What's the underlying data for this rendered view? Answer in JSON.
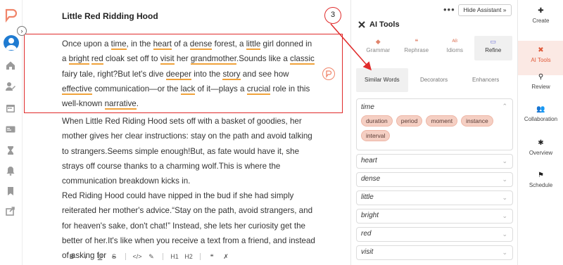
{
  "app": {
    "doc_title": "Little Red Ridding Hood",
    "accent_color": "#e05a3a",
    "highlight_color": "#e02b2b"
  },
  "left_rail": {
    "icons": [
      "logo-icon",
      "avatar",
      "home-icon",
      "user-edit-icon",
      "calendar-icon",
      "id-card-icon",
      "hourglass-icon",
      "bell-icon",
      "bookmark-icon",
      "share-icon"
    ]
  },
  "editor": {
    "p1": [
      {
        "t": "Once upon a "
      },
      {
        "t": "time",
        "u": true
      },
      {
        "t": ", in the "
      },
      {
        "t": "heart",
        "u": true
      },
      {
        "t": " of a "
      },
      {
        "t": "dense",
        "u": true
      },
      {
        "t": " forest, a "
      },
      {
        "t": "little",
        "u": true
      },
      {
        "t": " girl donned in a "
      },
      {
        "t": "bright",
        "u": true
      },
      {
        "t": " "
      },
      {
        "t": "red",
        "u": true
      },
      {
        "t": " cloak set off to "
      },
      {
        "t": "visit",
        "u": true
      },
      {
        "t": " her "
      },
      {
        "t": "grandmother",
        "u": true
      },
      {
        "t": ".Sounds like a "
      },
      {
        "t": "classic",
        "u": true
      },
      {
        "t": " fairy tale, right?But let's dive "
      },
      {
        "t": "deeper",
        "u": true
      },
      {
        "t": " into the "
      },
      {
        "t": "story",
        "u": true
      },
      {
        "t": " and see how "
      },
      {
        "t": "effective",
        "u": true
      },
      {
        "t": " communication—or the "
      },
      {
        "t": "lack",
        "u": true
      },
      {
        "t": " of it—plays a "
      },
      {
        "t": "crucial",
        "u": true
      },
      {
        "t": " role in this well-known "
      },
      {
        "t": "narrative",
        "u": true
      },
      {
        "t": "."
      }
    ],
    "p2": "When Little Red Riding Hood sets off with a basket of goodies, her mother gives her clear instructions: stay on the path and avoid talking to strangers.Seems simple enough!But, as fate would have it, she strays off course thanks to a charming wolf.This is where the communication breakdown kicks in.",
    "p3": "Red Riding Hood could have nipped in the bud if she had simply reiterated her mother's advice.“Stay on the path, avoid strangers, and for heaven's sake, don't chat!” Instead, she lets her curiosity get the better of her.It's like when you receive a text from a friend, and instead of asking for",
    "toolbar": [
      "B",
      "I",
      "U",
      "S",
      "</>",
      "✎",
      "H1",
      "H2",
      "❝",
      "✗"
    ]
  },
  "panel": {
    "more": "•••",
    "hide_label": "Hide Assistant »",
    "step_number": "3",
    "title": "AI Tools",
    "tools": [
      {
        "label": "Grammar",
        "icon": "◆",
        "active": false
      },
      {
        "label": "Rephrase",
        "icon": "❝",
        "active": false
      },
      {
        "label": "Idioms",
        "icon": "ᴬᴮ",
        "active": false
      },
      {
        "label": "Refine",
        "icon": "▭",
        "active": true
      }
    ],
    "subtabs": [
      {
        "label": "Similar Words",
        "active": true
      },
      {
        "label": "Decorators",
        "active": false
      },
      {
        "label": "Enhancers",
        "active": false
      }
    ],
    "expanded_word": "time",
    "synonyms": [
      "duration",
      "period",
      "moment",
      "instance",
      "interval"
    ],
    "collapsed_words": [
      "heart",
      "dense",
      "little",
      "bright",
      "red",
      "visit"
    ]
  },
  "right_nav": [
    {
      "label": "Create",
      "icon": "✚",
      "active": false
    },
    {
      "label": "AI Tools",
      "icon": "✖",
      "active": true
    },
    {
      "label": "Review",
      "icon": "⚲",
      "active": false
    },
    {
      "label": "Collaboration",
      "icon": "👥",
      "active": false
    },
    {
      "label": "Overview",
      "icon": "✱",
      "active": false
    },
    {
      "label": "Schedule",
      "icon": "⚑",
      "active": false
    }
  ]
}
